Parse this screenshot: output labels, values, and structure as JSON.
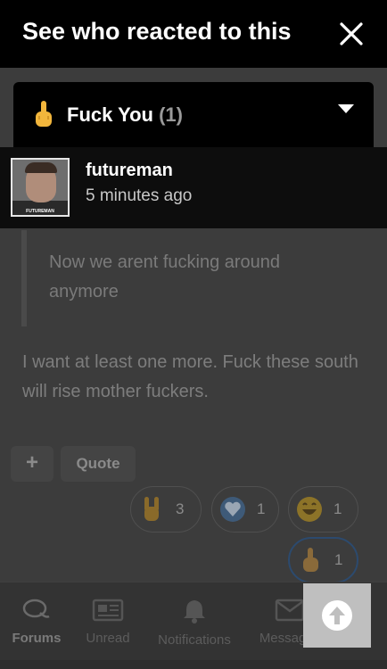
{
  "modal": {
    "title": "See who reacted to this",
    "filter": {
      "label": "Fuck You",
      "count": "(1)",
      "icon": "middle-finger-emoji"
    },
    "users": [
      {
        "name": "futureman",
        "time": "5 minutes ago",
        "avatar_caption": "FUTUREMAN"
      }
    ]
  },
  "post": {
    "quote": "Now we arent fucking around anymore",
    "body": "I want at least one more. Fuck these south will rise mother fuckers.",
    "actions": {
      "plus": "+",
      "quote": "Quote"
    },
    "reactions": [
      {
        "icon": "rock-on-emoji",
        "count": "3"
      },
      {
        "icon": "heart-emoji",
        "count": "1"
      },
      {
        "icon": "laughing-emoji",
        "count": "1"
      },
      {
        "icon": "middle-finger-emoji",
        "count": "1"
      }
    ]
  },
  "bottom_nav": {
    "items": [
      {
        "label": "Forums",
        "icon": "chat-bubbles-icon",
        "active": true
      },
      {
        "label": "Unread",
        "icon": "newspaper-icon"
      },
      {
        "label": "Notifications",
        "icon": "bell-icon"
      },
      {
        "label": "Messages",
        "icon": "envelope-icon"
      }
    ],
    "scroll_top_icon": "arrow-up-circle-icon"
  },
  "colors": {
    "overlay_bg": "#000000",
    "dim_page": "#3c3c3c",
    "scroll_button": "#bfbfbf"
  }
}
